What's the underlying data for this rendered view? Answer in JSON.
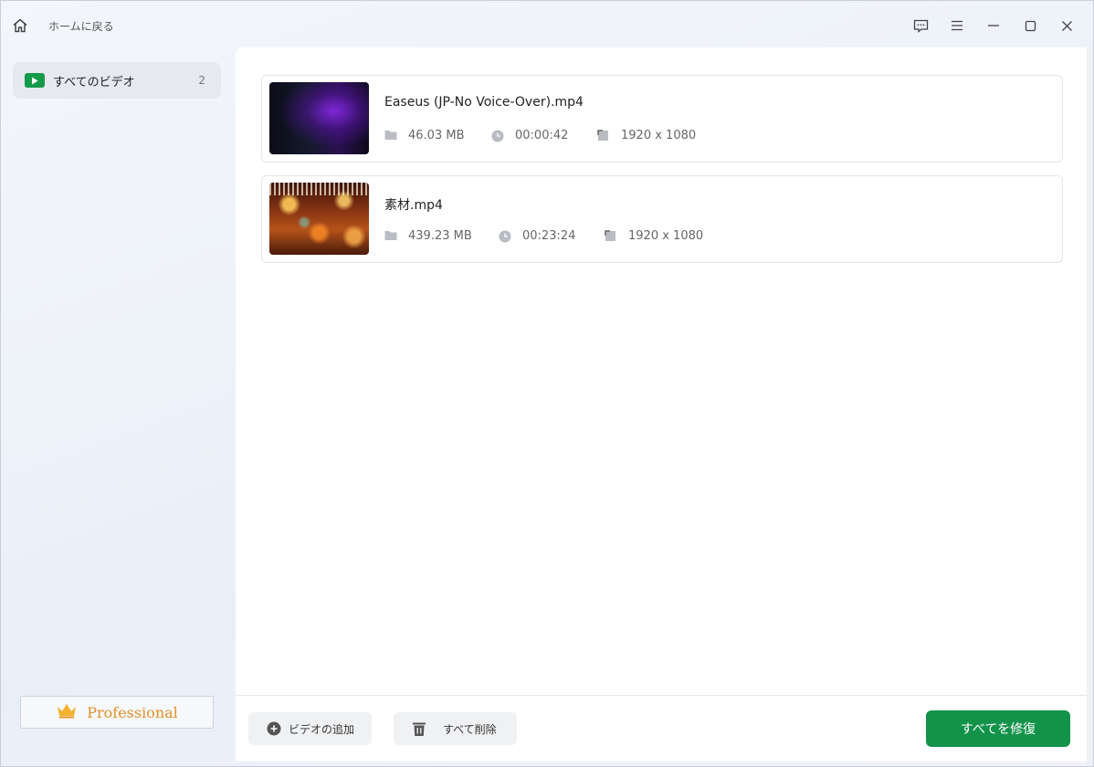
{
  "titlebar": {
    "home_icon": "home-icon",
    "back_label": "ホームに戻る",
    "controls": [
      "feedback-icon",
      "menu-icon",
      "minimize-icon",
      "maximize-icon",
      "close-icon"
    ]
  },
  "sidebar": {
    "items": [
      {
        "label": "すべてのビデオ",
        "count": "2",
        "icon": "play-icon"
      }
    ],
    "pro_label": "Professional",
    "pro_icon": "crown-icon"
  },
  "videos": [
    {
      "name": "Easeus (JP-No Voice-Over).mp4",
      "size": "46.03 MB",
      "duration": "00:00:42",
      "resolution": "1920 x 1080"
    },
    {
      "name": "素材.mp4",
      "size": "439.23 MB",
      "duration": "00:23:24",
      "resolution": "1920 x 1080"
    }
  ],
  "footer": {
    "add_label": "ビデオの追加",
    "delete_label": "すべて削除",
    "repair_label": "すべてを修復"
  },
  "colors": {
    "accent": "#13934a",
    "pro": "#e0902a"
  }
}
